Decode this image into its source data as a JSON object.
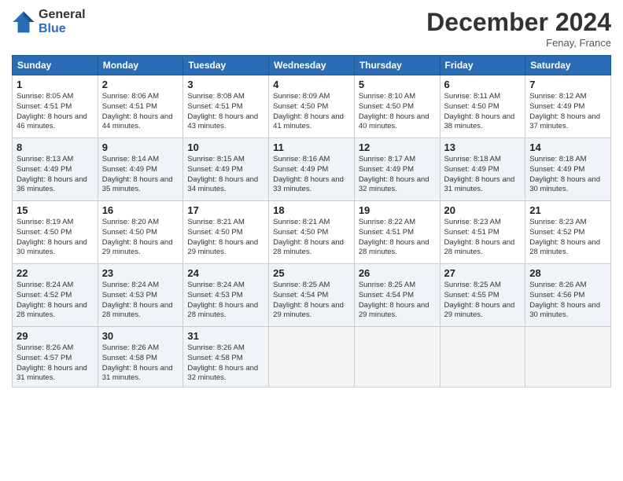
{
  "header": {
    "logo_line1": "General",
    "logo_line2": "Blue",
    "month_title": "December 2024",
    "location": "Fenay, France"
  },
  "weekdays": [
    "Sunday",
    "Monday",
    "Tuesday",
    "Wednesday",
    "Thursday",
    "Friday",
    "Saturday"
  ],
  "weeks": [
    [
      {
        "day": "1",
        "sunrise": "8:05 AM",
        "sunset": "4:51 PM",
        "daylight": "8 hours and 46 minutes."
      },
      {
        "day": "2",
        "sunrise": "8:06 AM",
        "sunset": "4:51 PM",
        "daylight": "8 hours and 44 minutes."
      },
      {
        "day": "3",
        "sunrise": "8:08 AM",
        "sunset": "4:51 PM",
        "daylight": "8 hours and 43 minutes."
      },
      {
        "day": "4",
        "sunrise": "8:09 AM",
        "sunset": "4:50 PM",
        "daylight": "8 hours and 41 minutes."
      },
      {
        "day": "5",
        "sunrise": "8:10 AM",
        "sunset": "4:50 PM",
        "daylight": "8 hours and 40 minutes."
      },
      {
        "day": "6",
        "sunrise": "8:11 AM",
        "sunset": "4:50 PM",
        "daylight": "8 hours and 38 minutes."
      },
      {
        "day": "7",
        "sunrise": "8:12 AM",
        "sunset": "4:49 PM",
        "daylight": "8 hours and 37 minutes."
      }
    ],
    [
      {
        "day": "8",
        "sunrise": "8:13 AM",
        "sunset": "4:49 PM",
        "daylight": "8 hours and 36 minutes."
      },
      {
        "day": "9",
        "sunrise": "8:14 AM",
        "sunset": "4:49 PM",
        "daylight": "8 hours and 35 minutes."
      },
      {
        "day": "10",
        "sunrise": "8:15 AM",
        "sunset": "4:49 PM",
        "daylight": "8 hours and 34 minutes."
      },
      {
        "day": "11",
        "sunrise": "8:16 AM",
        "sunset": "4:49 PM",
        "daylight": "8 hours and 33 minutes."
      },
      {
        "day": "12",
        "sunrise": "8:17 AM",
        "sunset": "4:49 PM",
        "daylight": "8 hours and 32 minutes."
      },
      {
        "day": "13",
        "sunrise": "8:18 AM",
        "sunset": "4:49 PM",
        "daylight": "8 hours and 31 minutes."
      },
      {
        "day": "14",
        "sunrise": "8:18 AM",
        "sunset": "4:49 PM",
        "daylight": "8 hours and 30 minutes."
      }
    ],
    [
      {
        "day": "15",
        "sunrise": "8:19 AM",
        "sunset": "4:50 PM",
        "daylight": "8 hours and 30 minutes."
      },
      {
        "day": "16",
        "sunrise": "8:20 AM",
        "sunset": "4:50 PM",
        "daylight": "8 hours and 29 minutes."
      },
      {
        "day": "17",
        "sunrise": "8:21 AM",
        "sunset": "4:50 PM",
        "daylight": "8 hours and 29 minutes."
      },
      {
        "day": "18",
        "sunrise": "8:21 AM",
        "sunset": "4:50 PM",
        "daylight": "8 hours and 28 minutes."
      },
      {
        "day": "19",
        "sunrise": "8:22 AM",
        "sunset": "4:51 PM",
        "daylight": "8 hours and 28 minutes."
      },
      {
        "day": "20",
        "sunrise": "8:23 AM",
        "sunset": "4:51 PM",
        "daylight": "8 hours and 28 minutes."
      },
      {
        "day": "21",
        "sunrise": "8:23 AM",
        "sunset": "4:52 PM",
        "daylight": "8 hours and 28 minutes."
      }
    ],
    [
      {
        "day": "22",
        "sunrise": "8:24 AM",
        "sunset": "4:52 PM",
        "daylight": "8 hours and 28 minutes."
      },
      {
        "day": "23",
        "sunrise": "8:24 AM",
        "sunset": "4:53 PM",
        "daylight": "8 hours and 28 minutes."
      },
      {
        "day": "24",
        "sunrise": "8:24 AM",
        "sunset": "4:53 PM",
        "daylight": "8 hours and 28 minutes."
      },
      {
        "day": "25",
        "sunrise": "8:25 AM",
        "sunset": "4:54 PM",
        "daylight": "8 hours and 29 minutes."
      },
      {
        "day": "26",
        "sunrise": "8:25 AM",
        "sunset": "4:54 PM",
        "daylight": "8 hours and 29 minutes."
      },
      {
        "day": "27",
        "sunrise": "8:25 AM",
        "sunset": "4:55 PM",
        "daylight": "8 hours and 29 minutes."
      },
      {
        "day": "28",
        "sunrise": "8:26 AM",
        "sunset": "4:56 PM",
        "daylight": "8 hours and 30 minutes."
      }
    ],
    [
      {
        "day": "29",
        "sunrise": "8:26 AM",
        "sunset": "4:57 PM",
        "daylight": "8 hours and 31 minutes."
      },
      {
        "day": "30",
        "sunrise": "8:26 AM",
        "sunset": "4:58 PM",
        "daylight": "8 hours and 31 minutes."
      },
      {
        "day": "31",
        "sunrise": "8:26 AM",
        "sunset": "4:58 PM",
        "daylight": "8 hours and 32 minutes."
      },
      null,
      null,
      null,
      null
    ]
  ]
}
